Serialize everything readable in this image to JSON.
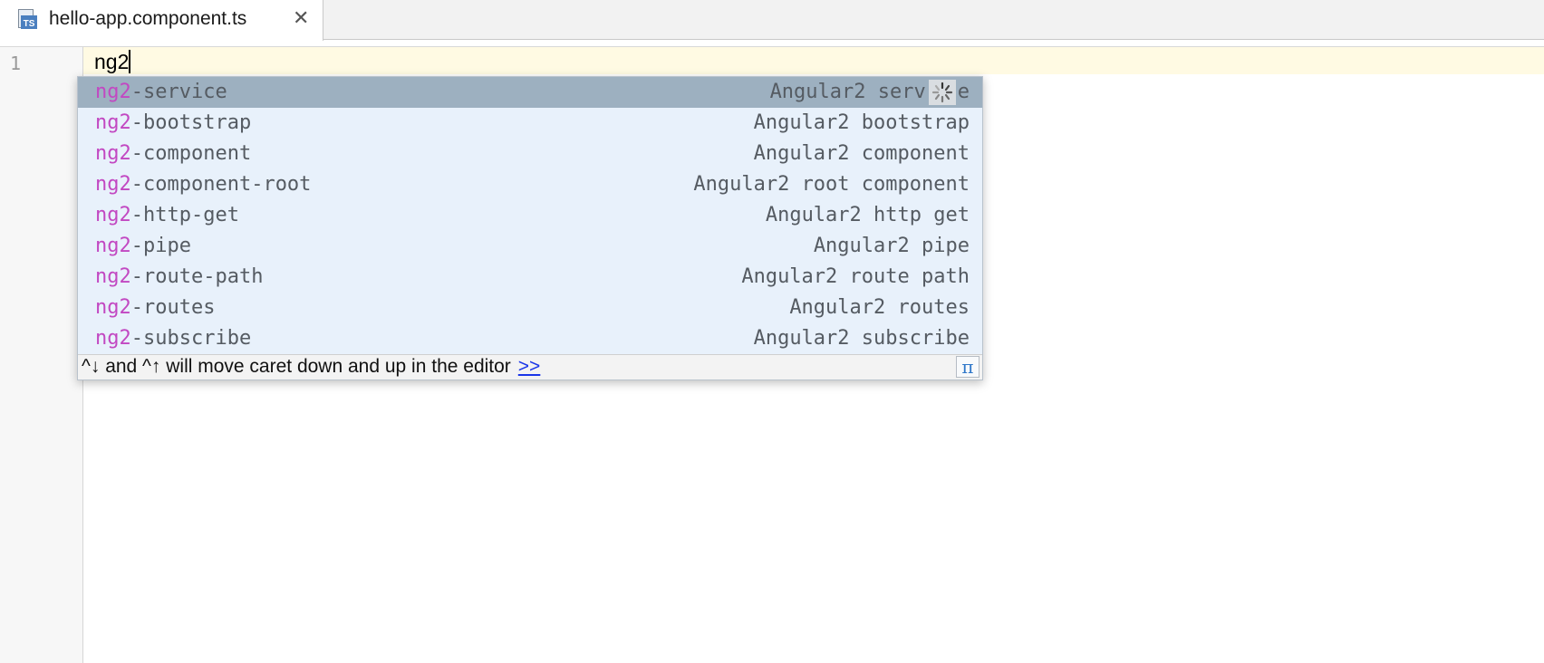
{
  "tab": {
    "icon": "typescript-file-icon",
    "icon_text": "TS",
    "filename": "hello-app.component.ts",
    "close_glyph": "✕"
  },
  "editor": {
    "line_numbers": [
      "1"
    ],
    "typed_text": "ng2"
  },
  "completion_popup": {
    "match_prefix": "ng2",
    "items": [
      {
        "suffix": "-service",
        "description": "Angular2 serv",
        "description_tail": "e",
        "selected": true
      },
      {
        "suffix": "-bootstrap",
        "description": "Angular2 bootstrap"
      },
      {
        "suffix": "-component",
        "description": "Angular2 component"
      },
      {
        "suffix": "-component-root",
        "description": "Angular2 root component"
      },
      {
        "suffix": "-http-get",
        "description": "Angular2 http get"
      },
      {
        "suffix": "-pipe",
        "description": "Angular2 pipe"
      },
      {
        "suffix": "-route-path",
        "description": "Angular2 route path"
      },
      {
        "suffix": "-routes",
        "description": "Angular2 routes"
      },
      {
        "suffix": "-subscribe",
        "description": "Angular2 subscribe"
      }
    ],
    "footer_hint": "^↓ and ^↑ will move caret down and up in the editor",
    "footer_link": ">>",
    "pi_symbol": "π",
    "loading_icon": "spinner-icon"
  },
  "colors": {
    "match_highlight": "#c248c2",
    "popup_background": "#e8f1fb",
    "selected_row": "#9db0c0",
    "current_line": "#fffae3",
    "link": "#1a36e8"
  }
}
